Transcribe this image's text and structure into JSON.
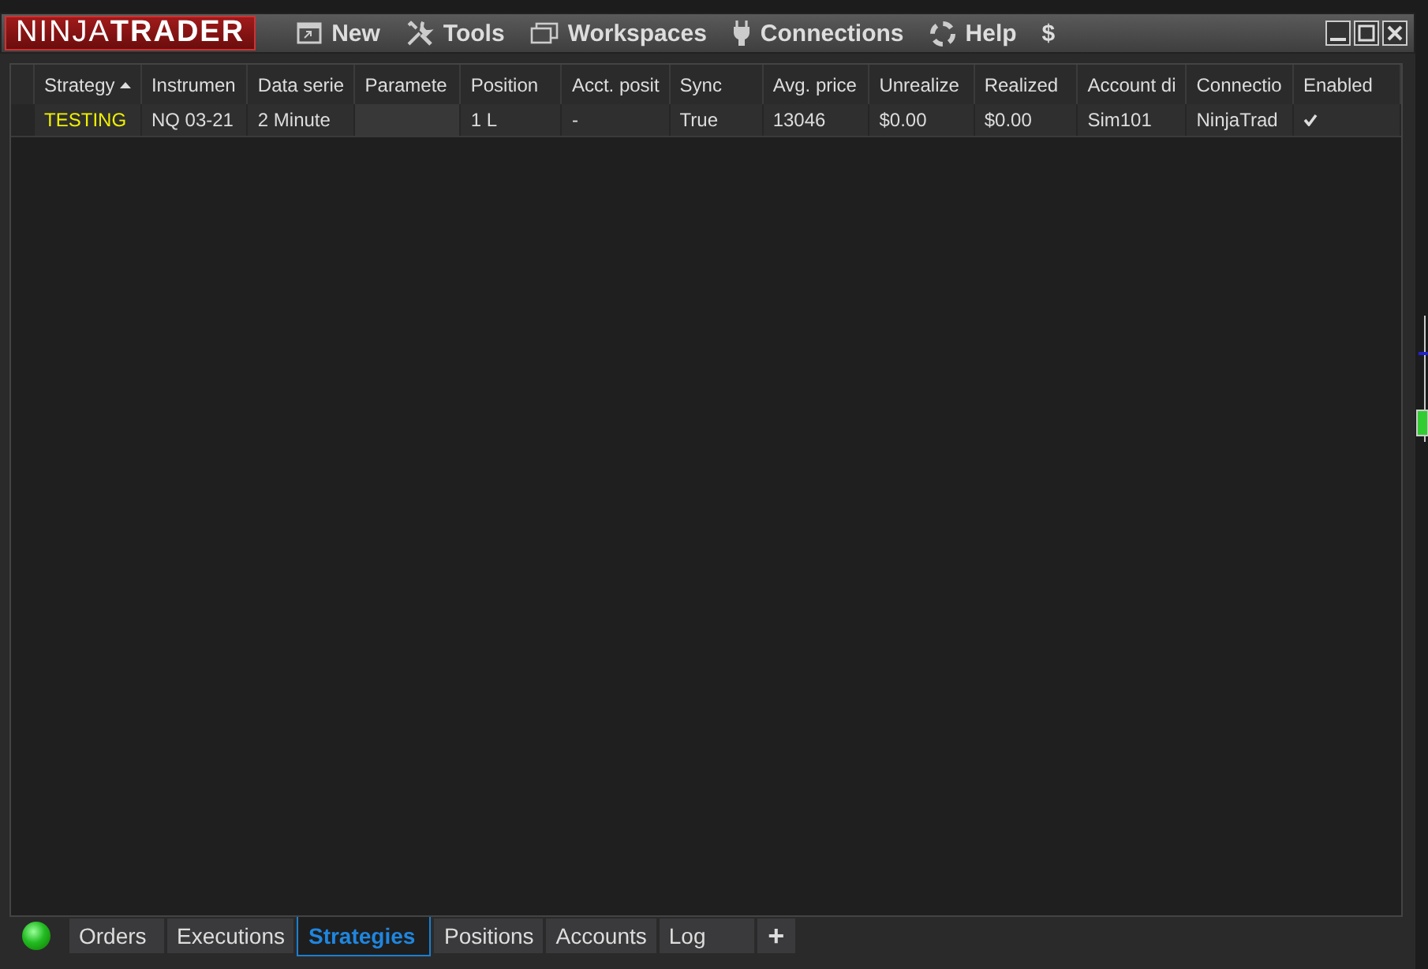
{
  "title_bar": {
    "logo_left": "NINJA",
    "logo_right": "TRADER",
    "menu": [
      {
        "label": "New"
      },
      {
        "label": "Tools"
      },
      {
        "label": "Workspaces"
      },
      {
        "label": "Connections"
      },
      {
        "label": "Help"
      },
      {
        "label": "$"
      }
    ]
  },
  "table": {
    "columns": [
      {
        "label": "Strategy",
        "sorted": true
      },
      {
        "label": "Instrumen",
        "sorted": false
      },
      {
        "label": "Data serie",
        "sorted": false
      },
      {
        "label": "Paramete",
        "sorted": false
      },
      {
        "label": "Position",
        "sorted": false
      },
      {
        "label": "Acct. posit",
        "sorted": false
      },
      {
        "label": "Sync",
        "sorted": false
      },
      {
        "label": "Avg. price",
        "sorted": false
      },
      {
        "label": "Unrealize",
        "sorted": false
      },
      {
        "label": "Realized",
        "sorted": false
      },
      {
        "label": "Account di",
        "sorted": false
      },
      {
        "label": "Connectio",
        "sorted": false
      },
      {
        "label": "Enabled",
        "sorted": false
      }
    ],
    "rows": [
      {
        "cells": [
          "TESTING",
          "NQ 03-21",
          "2 Minute",
          "",
          "1 L",
          "-",
          "True",
          "13046",
          "$0.00",
          "$0.00",
          "Sim101",
          "NinjaTrad"
        ],
        "enabled": true
      }
    ]
  },
  "bottom_tabs": [
    {
      "label": "Orders",
      "selected": false
    },
    {
      "label": "Executions",
      "selected": false
    },
    {
      "label": "Strategies",
      "selected": true
    },
    {
      "label": "Positions",
      "selected": false
    },
    {
      "label": "Accounts",
      "selected": false
    },
    {
      "label": "Log",
      "selected": false
    }
  ],
  "add_tab": "+"
}
